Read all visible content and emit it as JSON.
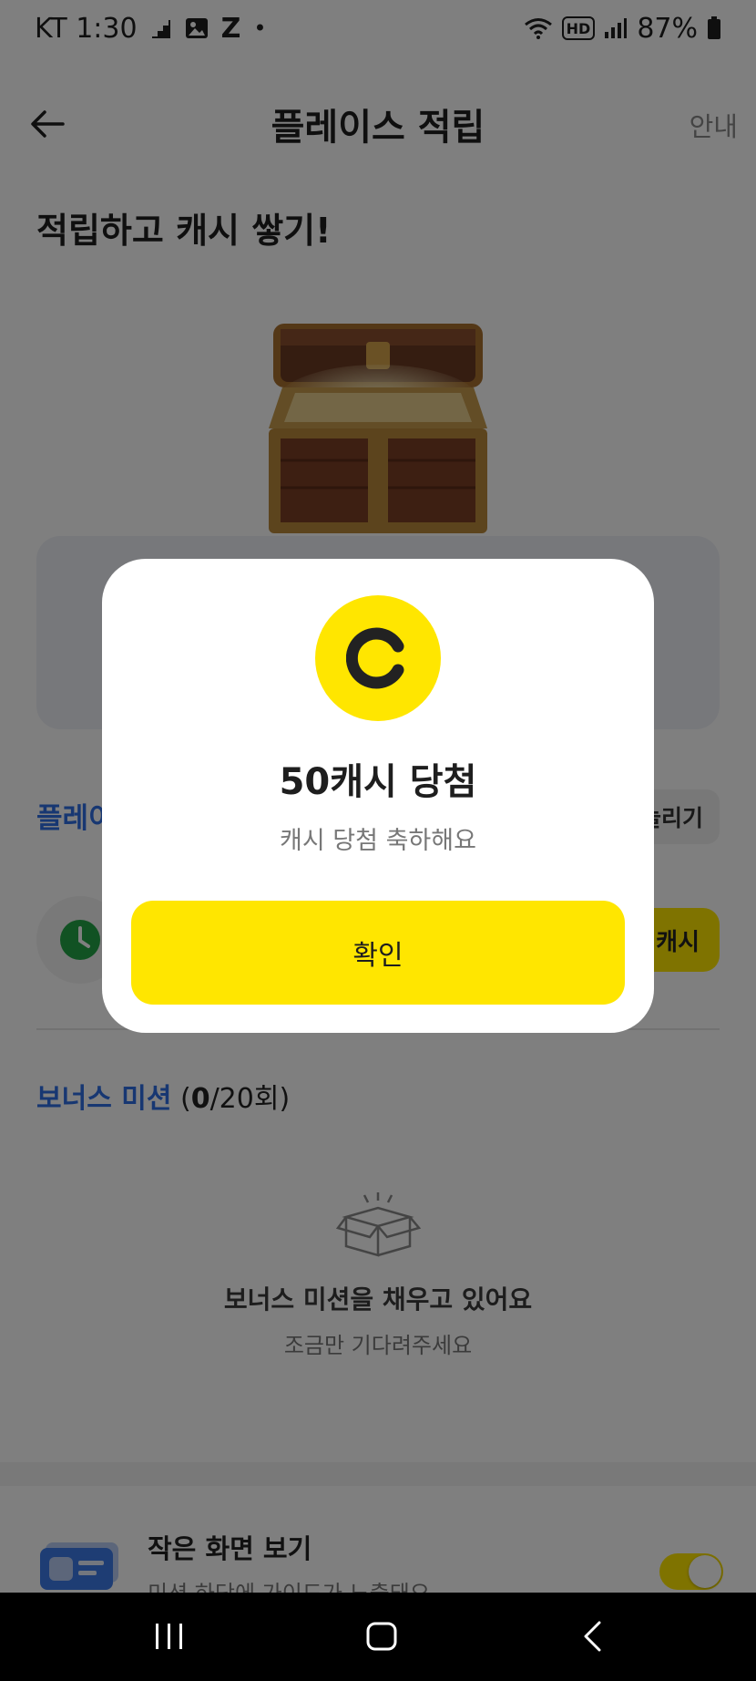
{
  "status_bar": {
    "carrier_time": "KT 1:30",
    "notification_icons": [
      "stairs-icon",
      "image-icon",
      "z-icon",
      "dot-icon"
    ],
    "z_glyph": "Z",
    "dot_glyph": "•",
    "hd_label": "HD",
    "battery": "87%"
  },
  "header": {
    "title": "플레이스 적립",
    "guide_label": "안내"
  },
  "page": {
    "headline": "적립하고 캐시 쌓기!"
  },
  "section": {
    "title_visible": "플레이",
    "pill_label_visible": "늘리기",
    "action_label_visible": "캐시"
  },
  "bonus": {
    "title": "보너스 미션",
    "count_open": " (",
    "count_current": "0",
    "count_total": "/20회)",
    "empty_title": "보너스 미션을 채우고 있어요",
    "empty_sub": "조금만 기다려주세요"
  },
  "setting": {
    "title": "작은 화면 보기",
    "sub": "미션 하단에 가이드가 노출돼요",
    "toggle_on": true
  },
  "modal": {
    "coin_icon": "cash-coin-icon",
    "title": "50캐시 당첨",
    "subtitle": "캐시 당첨 축하해요",
    "confirm_label": "확인"
  },
  "colors": {
    "accent_yellow": "#ffe600",
    "accent_blue": "#2f6fe4",
    "overlay": "rgba(0,0,0,0.5)"
  }
}
